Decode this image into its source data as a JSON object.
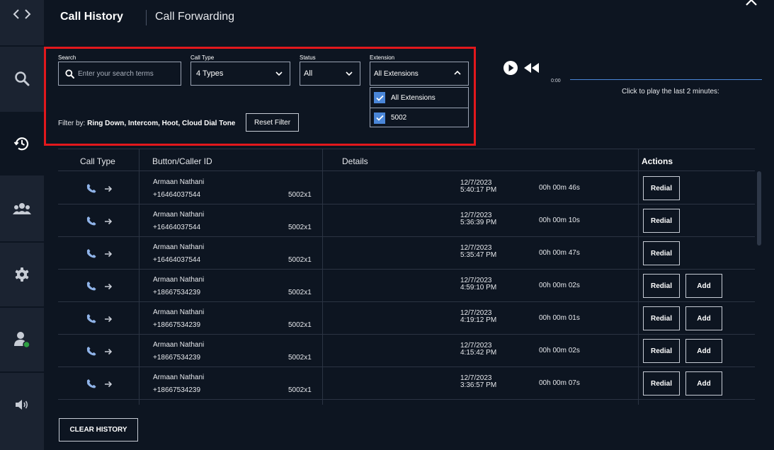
{
  "header": {
    "tabs": [
      {
        "label": "Call History"
      },
      {
        "label": "Call Forwarding"
      }
    ]
  },
  "filters": {
    "search": {
      "label": "Search",
      "placeholder": "Enter your search terms"
    },
    "call_type": {
      "label": "Call Type",
      "value": "4 Types"
    },
    "status": {
      "label": "Status",
      "value": "All"
    },
    "extension": {
      "label": "Extension",
      "value": "All Extensions",
      "options": [
        {
          "label": "All Extensions",
          "checked": true
        },
        {
          "label": "5002",
          "checked": true
        }
      ]
    },
    "filter_by_prefix": "Filter by: ",
    "filter_by_value": "Ring Down, Intercom, Hoot, Cloud Dial Tone",
    "reset_label": "Reset Filter"
  },
  "player": {
    "time": "0:00",
    "hint": "Click to play the last 2 minutes:"
  },
  "table": {
    "columns": [
      "Call Type",
      "Button/Caller ID",
      "Details",
      "Actions"
    ],
    "rows": [
      {
        "name": "Armaan Nathani",
        "number": "+16464037544",
        "ext": "5002x1",
        "date": "12/7/2023",
        "time": "5:40:17 PM",
        "duration": "00h 00m 46s",
        "add": false
      },
      {
        "name": "Armaan Nathani",
        "number": "+16464037544",
        "ext": "5002x1",
        "date": "12/7/2023",
        "time": "5:36:39 PM",
        "duration": "00h 00m 10s",
        "add": false
      },
      {
        "name": "Armaan Nathani",
        "number": "+16464037544",
        "ext": "5002x1",
        "date": "12/7/2023",
        "time": "5:35:47 PM",
        "duration": "00h 00m 47s",
        "add": false
      },
      {
        "name": "Armaan Nathani",
        "number": "+18667534239",
        "ext": "5002x1",
        "date": "12/7/2023",
        "time": "4:59:10 PM",
        "duration": "00h 00m 02s",
        "add": true
      },
      {
        "name": "Armaan Nathani",
        "number": "+18667534239",
        "ext": "5002x1",
        "date": "12/7/2023",
        "time": "4:19:12 PM",
        "duration": "00h 00m 01s",
        "add": true
      },
      {
        "name": "Armaan Nathani",
        "number": "+18667534239",
        "ext": "5002x1",
        "date": "12/7/2023",
        "time": "4:15:42 PM",
        "duration": "00h 00m 02s",
        "add": true
      },
      {
        "name": "Armaan Nathani",
        "number": "+18667534239",
        "ext": "5002x1",
        "date": "12/7/2023",
        "time": "3:36:57 PM",
        "duration": "00h 00m 07s",
        "add": true
      }
    ],
    "redial_label": "Redial",
    "add_label": "Add"
  },
  "clear_label": "CLEAR HISTORY",
  "colors": {
    "accent": "#4a86d8",
    "highlight": "#e2181c",
    "status_online": "#2ea043",
    "background": "#0d1521",
    "sidebar": "#1b2331"
  }
}
